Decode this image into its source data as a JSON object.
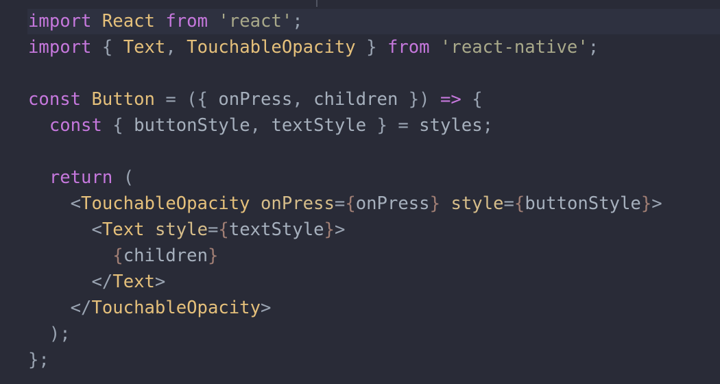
{
  "editor": {
    "language": "javascript",
    "active_line": 1,
    "lines": [
      [
        [
          "import",
          "kw"
        ],
        [
          " ",
          "p"
        ],
        [
          "React",
          "cls"
        ],
        [
          " ",
          "p"
        ],
        [
          "from",
          "kw"
        ],
        [
          " ",
          "p"
        ],
        [
          "'react'",
          "str"
        ],
        [
          ";",
          "p"
        ]
      ],
      [
        [
          "import",
          "kw"
        ],
        [
          " { ",
          "p"
        ],
        [
          "Text",
          "cls"
        ],
        [
          ", ",
          "p"
        ],
        [
          "TouchableOpacity",
          "cls"
        ],
        [
          " } ",
          "p"
        ],
        [
          "from",
          "kw"
        ],
        [
          " ",
          "p"
        ],
        [
          "'react-native'",
          "str"
        ],
        [
          ";",
          "p"
        ]
      ],
      [],
      [
        [
          "const",
          "kw"
        ],
        [
          " ",
          "p"
        ],
        [
          "Button",
          "cls"
        ],
        [
          " = ({ ",
          "p"
        ],
        [
          "onPress",
          "id"
        ],
        [
          ", ",
          "p"
        ],
        [
          "children",
          "id"
        ],
        [
          " }) ",
          "p"
        ],
        [
          "=>",
          "kw"
        ],
        [
          " {",
          "p"
        ]
      ],
      [
        [
          "  ",
          "p"
        ],
        [
          "const",
          "kw"
        ],
        [
          " { ",
          "p"
        ],
        [
          "buttonStyle",
          "id"
        ],
        [
          ", ",
          "p"
        ],
        [
          "textStyle",
          "id"
        ],
        [
          " } = ",
          "p"
        ],
        [
          "styles",
          "id"
        ],
        [
          ";",
          "p"
        ]
      ],
      [],
      [
        [
          "  ",
          "p"
        ],
        [
          "return",
          "kw"
        ],
        [
          " (",
          "p"
        ]
      ],
      [
        [
          "    <",
          "p"
        ],
        [
          "TouchableOpacity",
          "cls"
        ],
        [
          " ",
          "p"
        ],
        [
          "onPress",
          "attr"
        ],
        [
          "=",
          "p"
        ],
        [
          "{",
          "jb"
        ],
        [
          "onPress",
          "id"
        ],
        [
          "}",
          "jb"
        ],
        [
          " ",
          "p"
        ],
        [
          "style",
          "attr"
        ],
        [
          "=",
          "p"
        ],
        [
          "{",
          "jb"
        ],
        [
          "buttonStyle",
          "id"
        ],
        [
          "}",
          "jb"
        ],
        [
          ">",
          "p"
        ]
      ],
      [
        [
          "      <",
          "p"
        ],
        [
          "Text",
          "cls"
        ],
        [
          " ",
          "p"
        ],
        [
          "style",
          "attr"
        ],
        [
          "=",
          "p"
        ],
        [
          "{",
          "jb"
        ],
        [
          "textStyle",
          "id"
        ],
        [
          "}",
          "jb"
        ],
        [
          ">",
          "p"
        ]
      ],
      [
        [
          "        ",
          "p"
        ],
        [
          "{",
          "jb"
        ],
        [
          "children",
          "id"
        ],
        [
          "}",
          "jb"
        ]
      ],
      [
        [
          "      </",
          "p"
        ],
        [
          "Text",
          "cls"
        ],
        [
          ">",
          "p"
        ]
      ],
      [
        [
          "    </",
          "p"
        ],
        [
          "TouchableOpacity",
          "cls"
        ],
        [
          ">",
          "p"
        ]
      ],
      [
        [
          "  );",
          "p"
        ]
      ],
      [
        [
          "};",
          "p"
        ]
      ]
    ]
  }
}
